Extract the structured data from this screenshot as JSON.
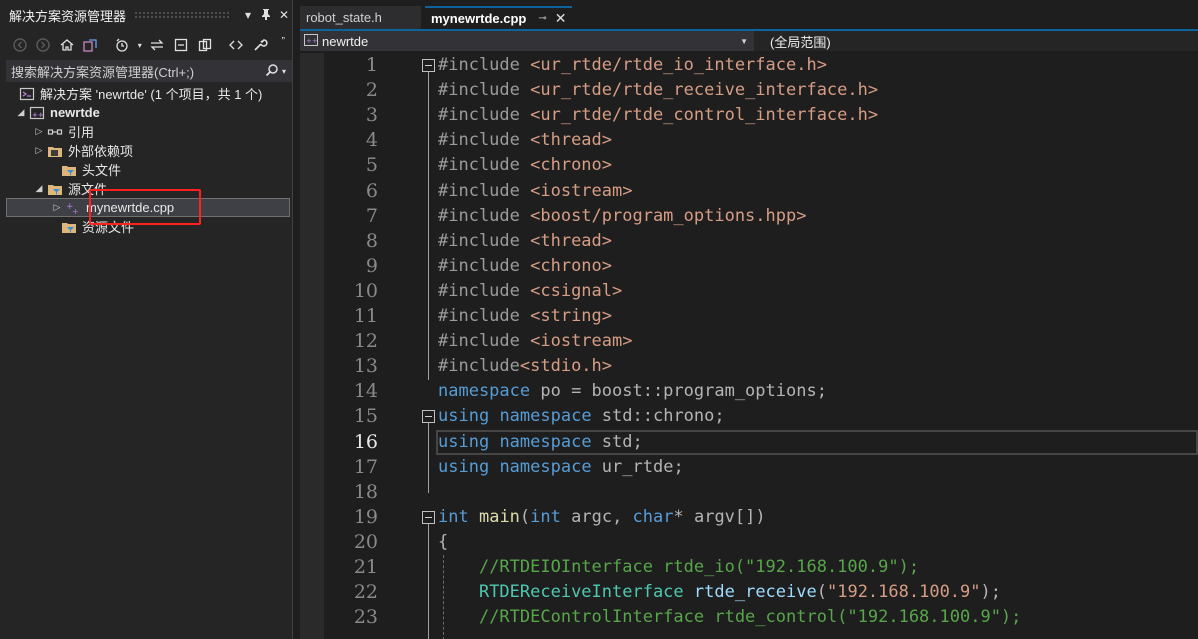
{
  "solution_explorer": {
    "title": "解决方案资源管理器",
    "search_placeholder": "搜索解决方案资源管理器(Ctrl+;)",
    "tree": [
      {
        "label": "解决方案 'newrtde' (1 个项目，共 1 个)",
        "icon": "solution-icon",
        "indent": 1,
        "expander": ""
      },
      {
        "label": "newrtde",
        "icon": "project-icon",
        "indent": 1,
        "expander": "◢",
        "bold": true
      },
      {
        "label": "引用",
        "icon": "references-icon",
        "indent": 2,
        "expander": "▷"
      },
      {
        "label": "外部依赖项",
        "icon": "external-deps-icon",
        "indent": 2,
        "expander": "▷"
      },
      {
        "label": "头文件",
        "icon": "filter-folder-icon",
        "indent": 2,
        "expander": ""
      },
      {
        "label": "源文件",
        "icon": "filter-folder-icon",
        "indent": 2,
        "expander": "◢"
      },
      {
        "label": "mynewrtde.cpp",
        "icon": "cpp-file-icon",
        "indent": 3,
        "expander": "▷",
        "selected": true
      },
      {
        "label": "资源文件",
        "icon": "filter-folder-icon",
        "indent": 2,
        "expander": ""
      }
    ]
  },
  "tabs": [
    {
      "label": "robot_state.h",
      "active": false
    },
    {
      "label": "mynewrtde.cpp",
      "active": true
    }
  ],
  "nav": {
    "project": "newrtde",
    "scope": "(全局范围)"
  },
  "editor": {
    "current_line": 16,
    "lines": [
      {
        "n": "1",
        "tokens": [
          [
            "pp",
            "#include "
          ],
          [
            "str",
            "<ur_rtde/rtde_io_interface.h>"
          ]
        ]
      },
      {
        "n": "2",
        "tokens": [
          [
            "pp",
            "#include "
          ],
          [
            "str",
            "<ur_rtde/rtde_receive_interface.h>"
          ]
        ]
      },
      {
        "n": "3",
        "tokens": [
          [
            "pp",
            "#include "
          ],
          [
            "str",
            "<ur_rtde/rtde_control_interface.h>"
          ]
        ]
      },
      {
        "n": "4",
        "tokens": [
          [
            "pp",
            "#include "
          ],
          [
            "str",
            "<thread>"
          ]
        ]
      },
      {
        "n": "5",
        "tokens": [
          [
            "pp",
            "#include "
          ],
          [
            "str",
            "<chrono>"
          ]
        ]
      },
      {
        "n": "6",
        "tokens": [
          [
            "pp",
            "#include "
          ],
          [
            "str",
            "<iostream>"
          ]
        ]
      },
      {
        "n": "7",
        "tokens": [
          [
            "pp",
            "#include "
          ],
          [
            "str",
            "<boost/program_options.hpp>"
          ]
        ]
      },
      {
        "n": "8",
        "tokens": [
          [
            "pp",
            "#include "
          ],
          [
            "str",
            "<thread>"
          ]
        ]
      },
      {
        "n": "9",
        "tokens": [
          [
            "pp",
            "#include "
          ],
          [
            "str",
            "<chrono>"
          ]
        ]
      },
      {
        "n": "10",
        "tokens": [
          [
            "pp",
            "#include "
          ],
          [
            "str",
            "<csignal>"
          ]
        ]
      },
      {
        "n": "11",
        "tokens": [
          [
            "pp",
            "#include "
          ],
          [
            "str",
            "<string>"
          ]
        ]
      },
      {
        "n": "12",
        "tokens": [
          [
            "pp",
            "#include "
          ],
          [
            "str",
            "<iostream>"
          ]
        ]
      },
      {
        "n": "13",
        "tokens": [
          [
            "pp",
            "#include"
          ],
          [
            "str",
            "<stdio.h>"
          ]
        ]
      },
      {
        "n": "14",
        "tokens": [
          [
            "kw",
            "namespace"
          ],
          [
            "op",
            " po = boost::program_options;"
          ]
        ]
      },
      {
        "n": "15",
        "tokens": [
          [
            "kw",
            "using"
          ],
          [
            "op",
            " "
          ],
          [
            "kw",
            "namespace"
          ],
          [
            "op",
            " std::chrono;"
          ]
        ]
      },
      {
        "n": "16",
        "tokens": [
          [
            "kw",
            "using"
          ],
          [
            "op",
            " "
          ],
          [
            "kw",
            "namespace"
          ],
          [
            "op",
            " std;"
          ]
        ]
      },
      {
        "n": "17",
        "tokens": [
          [
            "kw",
            "using"
          ],
          [
            "op",
            " "
          ],
          [
            "kw",
            "namespace"
          ],
          [
            "op",
            " ur_rtde;"
          ]
        ]
      },
      {
        "n": "18",
        "tokens": []
      },
      {
        "n": "19",
        "tokens": [
          [
            "kw",
            "int"
          ],
          [
            "op",
            " "
          ],
          [
            "fn",
            "main"
          ],
          [
            "op",
            "("
          ],
          [
            "kw",
            "int"
          ],
          [
            "op",
            " argc, "
          ],
          [
            "kw",
            "char"
          ],
          [
            "op",
            "* argv[])"
          ]
        ]
      },
      {
        "n": "20",
        "tokens": [
          [
            "op",
            "{"
          ]
        ]
      },
      {
        "n": "21",
        "tokens": [
          [
            "op",
            "    "
          ],
          [
            "cm",
            "//RTDEIOInterface rtde_io(\"192.168.100.9\");"
          ]
        ]
      },
      {
        "n": "22",
        "tokens": [
          [
            "op",
            "    "
          ],
          [
            "ty",
            "RTDEReceiveInterface"
          ],
          [
            "op",
            " "
          ],
          [
            "var",
            "rtde_receive"
          ],
          [
            "op",
            "("
          ],
          [
            "str",
            "\"192.168.100.9\""
          ],
          [
            "op",
            ");"
          ]
        ]
      },
      {
        "n": "23",
        "tokens": [
          [
            "op",
            "    "
          ],
          [
            "cm",
            "//RTDEControlInterface rtde_control(\"192.168.100.9\");"
          ]
        ]
      }
    ]
  }
}
